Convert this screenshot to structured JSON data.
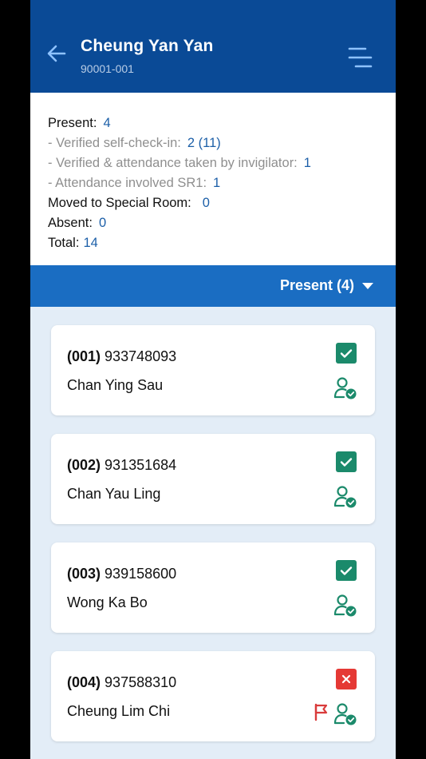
{
  "header": {
    "title": "Cheung Yan Yan",
    "subtitle": "90001-001"
  },
  "summary": {
    "present_label": "Present:",
    "present_value": "4",
    "verified_self_label": "- Verified self-check-in:",
    "verified_self_value": "2 (11)",
    "verified_invig_label": "- Verified & attendance taken by invigilator:",
    "verified_invig_value": "1",
    "sr1_label": "- Attendance involved SR1:",
    "sr1_value": "1",
    "moved_label": "Moved to Special Room:",
    "moved_value": "0",
    "absent_label": "Absent:",
    "absent_value": "0",
    "total_label": "Total:",
    "total_value": "14"
  },
  "filter": {
    "label": "Present (4)"
  },
  "candidates": [
    {
      "seat": "(001)",
      "number": "933748093",
      "name": "Chan Ying Sau",
      "status": "checked",
      "flagged": false
    },
    {
      "seat": "(002)",
      "number": "931351684",
      "name": "Chan Yau Ling",
      "status": "checked",
      "flagged": false
    },
    {
      "seat": "(003)",
      "number": "939158600",
      "name": "Wong Ka Bo",
      "status": "checked",
      "flagged": false
    },
    {
      "seat": "(004)",
      "number": "937588310",
      "name": "Cheung Lim Chi",
      "status": "rejected",
      "flagged": true
    }
  ],
  "icons": {
    "back": "arrow-left-icon",
    "menu": "menu-icon",
    "status_checked": "checkbox-checked-icon",
    "status_rejected": "close-box-icon",
    "person": "person-verified-icon",
    "flag": "flag-icon"
  },
  "colors": {
    "header_bg": "#0a4a96",
    "filter_bg": "#1a6dc2",
    "page_bg": "#e3edf7",
    "value_blue": "#1c5fa8",
    "status_green": "#1b8a6b",
    "status_red": "#e53935",
    "flag_red": "#d93b3b"
  }
}
